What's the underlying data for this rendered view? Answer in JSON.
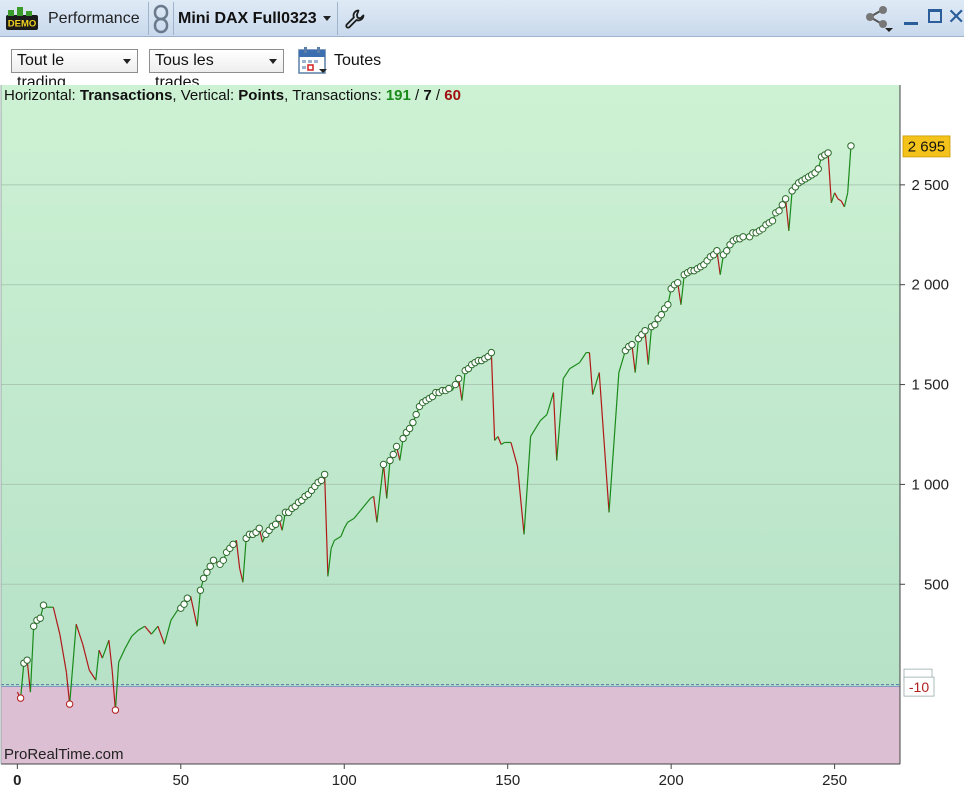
{
  "window": {
    "badge": "DEMO",
    "section": "Performance",
    "instrument": "Mini DAX Full0323"
  },
  "toolbar": {
    "scope_dropdown": "Tout le trading",
    "trades_dropdown": "Tous les trades",
    "period_label": "Toutes"
  },
  "info": {
    "h_prefix": "Horizontal: ",
    "h_value": "Transactions",
    "v_prefix": ", Vertical: ",
    "v_value": "Points",
    "t_prefix": ", Transactions: ",
    "winners": "191",
    "sep1": " / ",
    "neutral": "7",
    "sep2": " / ",
    "losers": "60"
  },
  "watermark": "ProRealTime.com",
  "colors": {
    "up": "#1a8a1a",
    "down": "#b01818",
    "positive_zone_top": "#cdf1d3",
    "positive_zone_bottom": "#b7e2c8",
    "negative_zone": "#dcbfd2",
    "last_value_bg": "#f3c21b"
  },
  "chart_data": {
    "type": "line",
    "xlabel": "",
    "ylabel": "",
    "xlim": [
      -5,
      270
    ],
    "ylim": [
      -400,
      3000
    ],
    "x_ticks": [
      0,
      50,
      100,
      150,
      200,
      250
    ],
    "x_tick_labels": [
      "0",
      "50",
      "100",
      "150",
      "200",
      "250"
    ],
    "y_ticks": [
      500,
      1000,
      1500,
      2000,
      2500
    ],
    "y_tick_labels": [
      "500",
      "1 000",
      "1 500",
      "2 000",
      "2 500"
    ],
    "last_value": 2695,
    "last_value_label": "2 695",
    "reference_value": -10,
    "reference_label": "-10",
    "grid": true,
    "points": [
      [
        0,
        -40
      ],
      [
        1,
        -70
      ],
      [
        2,
        105
      ],
      [
        3,
        120
      ],
      [
        4,
        -40
      ],
      [
        5,
        290
      ],
      [
        6,
        320
      ],
      [
        7,
        330
      ],
      [
        8,
        395
      ],
      [
        9,
        385
      ],
      [
        11,
        385
      ],
      [
        13,
        250
      ],
      [
        15,
        60
      ],
      [
        16,
        -100
      ],
      [
        18,
        300
      ],
      [
        20,
        200
      ],
      [
        22,
        70
      ],
      [
        24,
        20
      ],
      [
        25,
        170
      ],
      [
        26,
        130
      ],
      [
        28,
        220
      ],
      [
        29,
        70
      ],
      [
        30,
        -130
      ],
      [
        31,
        110
      ],
      [
        33,
        180
      ],
      [
        35,
        240
      ],
      [
        37,
        270
      ],
      [
        39,
        290
      ],
      [
        41,
        250
      ],
      [
        43,
        290
      ],
      [
        45,
        200
      ],
      [
        47,
        320
      ],
      [
        49,
        370
      ],
      [
        50,
        380
      ],
      [
        51,
        400
      ],
      [
        52,
        430
      ],
      [
        53,
        440
      ],
      [
        55,
        290
      ],
      [
        56,
        470
      ],
      [
        57,
        530
      ],
      [
        58,
        560
      ],
      [
        59,
        590
      ],
      [
        60,
        620
      ],
      [
        62,
        600
      ],
      [
        63,
        620
      ],
      [
        64,
        660
      ],
      [
        65,
        680
      ],
      [
        66,
        700
      ],
      [
        67,
        720
      ],
      [
        68,
        580
      ],
      [
        69,
        510
      ],
      [
        70,
        730
      ],
      [
        71,
        750
      ],
      [
        72,
        750
      ],
      [
        73,
        760
      ],
      [
        74,
        780
      ],
      [
        75,
        710
      ],
      [
        76,
        750
      ],
      [
        77,
        770
      ],
      [
        78,
        790
      ],
      [
        79,
        800
      ],
      [
        80,
        830
      ],
      [
        81,
        770
      ],
      [
        82,
        860
      ],
      [
        83,
        860
      ],
      [
        84,
        880
      ],
      [
        85,
        890
      ],
      [
        86,
        910
      ],
      [
        87,
        920
      ],
      [
        88,
        940
      ],
      [
        89,
        950
      ],
      [
        90,
        970
      ],
      [
        91,
        990
      ],
      [
        92,
        1010
      ],
      [
        93,
        1020
      ],
      [
        94,
        1050
      ],
      [
        95,
        540
      ],
      [
        96,
        680
      ],
      [
        97,
        720
      ],
      [
        98,
        730
      ],
      [
        99,
        740
      ],
      [
        100,
        780
      ],
      [
        101,
        810
      ],
      [
        102,
        820
      ],
      [
        103,
        830
      ],
      [
        104,
        850
      ],
      [
        105,
        870
      ],
      [
        106,
        890
      ],
      [
        107,
        910
      ],
      [
        108,
        930
      ],
      [
        109,
        940
      ],
      [
        110,
        810
      ],
      [
        111,
        960
      ],
      [
        112,
        1100
      ],
      [
        113,
        930
      ],
      [
        114,
        1120
      ],
      [
        115,
        1150
      ],
      [
        116,
        1190
      ],
      [
        117,
        1120
      ],
      [
        118,
        1230
      ],
      [
        119,
        1260
      ],
      [
        120,
        1280
      ],
      [
        121,
        1310
      ],
      [
        122,
        1350
      ],
      [
        123,
        1390
      ],
      [
        124,
        1410
      ],
      [
        125,
        1420
      ],
      [
        126,
        1430
      ],
      [
        127,
        1440
      ],
      [
        128,
        1460
      ],
      [
        129,
        1460
      ],
      [
        130,
        1470
      ],
      [
        131,
        1470
      ],
      [
        132,
        1480
      ],
      [
        133,
        1470
      ],
      [
        134,
        1500
      ],
      [
        135,
        1530
      ],
      [
        136,
        1420
      ],
      [
        137,
        1570
      ],
      [
        138,
        1580
      ],
      [
        139,
        1600
      ],
      [
        140,
        1610
      ],
      [
        141,
        1620
      ],
      [
        142,
        1620
      ],
      [
        143,
        1630
      ],
      [
        144,
        1640
      ],
      [
        145,
        1660
      ],
      [
        146,
        1220
      ],
      [
        147,
        1240
      ],
      [
        148,
        1200
      ],
      [
        149,
        1210
      ],
      [
        151,
        1210
      ],
      [
        153,
        1090
      ],
      [
        155,
        750
      ],
      [
        157,
        1240
      ],
      [
        160,
        1320
      ],
      [
        162,
        1350
      ],
      [
        164,
        1460
      ],
      [
        165,
        1120
      ],
      [
        167,
        1530
      ],
      [
        169,
        1580
      ],
      [
        171,
        1600
      ],
      [
        172,
        1610
      ],
      [
        174,
        1660
      ],
      [
        175,
        1660
      ],
      [
        176,
        1450
      ],
      [
        178,
        1560
      ],
      [
        181,
        860
      ],
      [
        184,
        1560
      ],
      [
        186,
        1670
      ],
      [
        187,
        1690
      ],
      [
        188,
        1700
      ],
      [
        189,
        1560
      ],
      [
        190,
        1730
      ],
      [
        191,
        1750
      ],
      [
        192,
        1770
      ],
      [
        193,
        1600
      ],
      [
        194,
        1790
      ],
      [
        195,
        1800
      ],
      [
        196,
        1830
      ],
      [
        197,
        1850
      ],
      [
        198,
        1880
      ],
      [
        199,
        1900
      ],
      [
        200,
        1980
      ],
      [
        201,
        2000
      ],
      [
        202,
        2010
      ],
      [
        203,
        1900
      ],
      [
        204,
        2050
      ],
      [
        205,
        2060
      ],
      [
        206,
        2070
      ],
      [
        207,
        2070
      ],
      [
        208,
        2080
      ],
      [
        209,
        2090
      ],
      [
        210,
        2100
      ],
      [
        211,
        2120
      ],
      [
        212,
        2140
      ],
      [
        213,
        2150
      ],
      [
        214,
        2170
      ],
      [
        215,
        2050
      ],
      [
        216,
        2150
      ],
      [
        217,
        2170
      ],
      [
        218,
        2200
      ],
      [
        219,
        2220
      ],
      [
        220,
        2230
      ],
      [
        221,
        2230
      ],
      [
        222,
        2240
      ],
      [
        224,
        2240
      ],
      [
        225,
        2260
      ],
      [
        226,
        2260
      ],
      [
        227,
        2270
      ],
      [
        228,
        2280
      ],
      [
        229,
        2300
      ],
      [
        230,
        2310
      ],
      [
        231,
        2320
      ],
      [
        232,
        2360
      ],
      [
        233,
        2370
      ],
      [
        234,
        2400
      ],
      [
        235,
        2430
      ],
      [
        236,
        2270
      ],
      [
        237,
        2470
      ],
      [
        238,
        2490
      ],
      [
        239,
        2510
      ],
      [
        240,
        2520
      ],
      [
        241,
        2530
      ],
      [
        242,
        2540
      ],
      [
        243,
        2550
      ],
      [
        244,
        2560
      ],
      [
        245,
        2580
      ],
      [
        246,
        2640
      ],
      [
        247,
        2650
      ],
      [
        248,
        2660
      ],
      [
        249,
        2410
      ],
      [
        250,
        2460
      ],
      [
        251,
        2430
      ],
      [
        252,
        2420
      ],
      [
        253,
        2390
      ],
      [
        254,
        2460
      ],
      [
        255,
        2695
      ]
    ],
    "marker_indices": [
      1,
      2,
      3,
      5,
      6,
      7,
      8,
      16,
      30,
      50,
      51,
      52,
      56,
      57,
      58,
      59,
      60,
      62,
      63,
      64,
      65,
      66,
      70,
      71,
      72,
      73,
      74,
      76,
      77,
      78,
      79,
      80,
      82,
      83,
      84,
      85,
      86,
      87,
      88,
      89,
      90,
      91,
      92,
      93,
      94,
      112,
      114,
      115,
      116,
      118,
      119,
      120,
      121,
      122,
      123,
      124,
      125,
      126,
      127,
      128,
      129,
      130,
      131,
      132,
      134,
      135,
      137,
      138,
      139,
      140,
      141,
      142,
      143,
      144,
      145,
      186,
      187,
      188,
      190,
      191,
      192,
      194,
      195,
      196,
      197,
      198,
      199,
      200,
      201,
      202,
      204,
      205,
      206,
      207,
      208,
      209,
      210,
      211,
      212,
      213,
      214,
      216,
      217,
      218,
      219,
      220,
      221,
      222,
      224,
      225,
      226,
      227,
      228,
      229,
      230,
      231,
      232,
      233,
      234,
      235,
      237,
      238,
      239,
      240,
      241,
      242,
      243,
      244,
      245,
      246,
      247,
      248,
      255
    ]
  }
}
